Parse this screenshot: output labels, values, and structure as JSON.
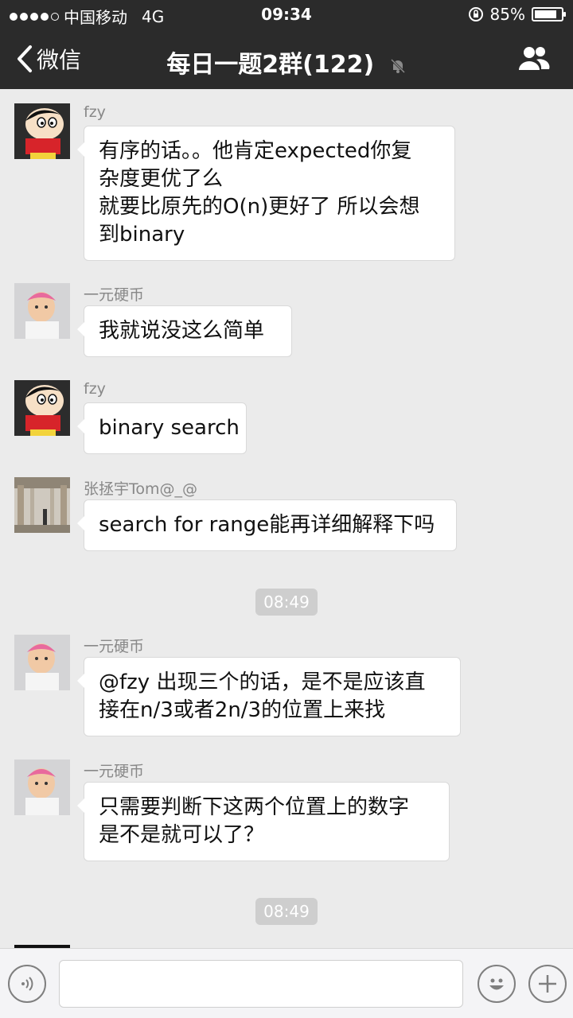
{
  "status_bar": {
    "carrier": "中国移动",
    "network": "4G",
    "time": "09:34",
    "battery": "85%",
    "battery_level": 0.85
  },
  "nav": {
    "back_label": "微信",
    "title": "每日一题2群(122)"
  },
  "messages": [
    {
      "sender": "fzy",
      "avatar": "cartoon-boy-avatar",
      "lines": [
        "有序的话。。他肯定expected你复",
        "杂度更优了么",
        "就要比原先的O(n)更好了 所以会想",
        "到binary"
      ]
    },
    {
      "sender": "一元硬币",
      "avatar": "baby-avatar",
      "lines": [
        "我就说没这么简单"
      ]
    },
    {
      "sender": "fzy",
      "avatar": "cartoon-boy-avatar",
      "lines": [
        "binary search"
      ]
    },
    {
      "sender": "张拯宇Tom@_@",
      "avatar": "hallway-photo-avatar",
      "lines": [
        "search for range能再详细解释下吗"
      ]
    },
    {
      "sender": "一元硬币",
      "avatar": "baby-avatar",
      "lines": [
        "@fzy 出现三个的话，是不是应该直",
        "接在n/3或者2n/3的位置上来找"
      ]
    },
    {
      "sender": "一元硬币",
      "avatar": "baby-avatar",
      "lines": [
        "只需要判断下这两个位置上的数字",
        "是不是就可以了？"
      ]
    }
  ],
  "timestamps": [
    "08:49",
    "08:49"
  ],
  "colors": {
    "nav_bg": "#2b2b2b",
    "chat_bg": "#ebebeb",
    "bubble_bg": "#ffffff",
    "sender_text": "#888888",
    "timestamp_bg": "#cecece"
  },
  "icons": {
    "back": "chevron-left-icon",
    "mute": "bell-off-icon",
    "members": "people-icon",
    "voice": "voice-icon",
    "emoji": "smiley-icon",
    "plus": "plus-icon"
  }
}
